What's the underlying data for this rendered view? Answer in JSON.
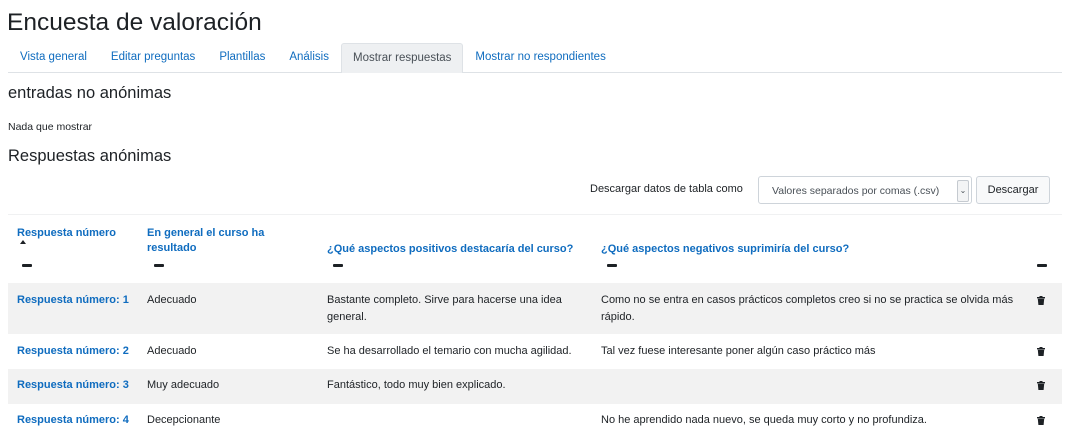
{
  "page": {
    "title": "Encuesta de valoración"
  },
  "tabs": [
    {
      "label": "Vista general"
    },
    {
      "label": "Editar preguntas"
    },
    {
      "label": "Plantillas"
    },
    {
      "label": "Análisis"
    },
    {
      "label": "Mostrar respuestas",
      "active": true
    },
    {
      "label": "Mostrar no respondientes"
    }
  ],
  "nonanonymous": {
    "heading": "entradas no anónimas",
    "empty_text": "Nada que mostrar"
  },
  "anonymous": {
    "heading": "Respuestas anónimas",
    "download_label": "Descargar datos de tabla como",
    "download_format": "Valores separados por comas (.csv)",
    "download_button": "Descargar"
  },
  "table": {
    "headers": {
      "number": "Respuesta número",
      "overall": "En general el curso ha resultado",
      "positive": "¿Qué aspectos positivos destacaría del curso?",
      "negative": "¿Qué aspectos negativos suprimiría del curso?"
    },
    "rows": [
      {
        "number": "Respuesta número: 1",
        "overall": "Adecuado",
        "positive": "Bastante completo. Sirve para hacerse una idea general.",
        "negative": "Como no se entra en casos prácticos completos creo si no se practica se olvida más rápido."
      },
      {
        "number": "Respuesta número: 2",
        "overall": "Adecuado",
        "positive": "Se ha desarrollado el temario con mucha agilidad.",
        "negative": "Tal vez fuese interesante poner algún caso práctico más"
      },
      {
        "number": "Respuesta número: 3",
        "overall": "Muy adecuado",
        "positive": "Fantástico, todo muy bien explicado.",
        "negative": ""
      },
      {
        "number": "Respuesta número: 4",
        "overall": "Decepcionante",
        "positive": "",
        "negative": "No he aprendido nada nuevo, se queda muy corto y no profundiza."
      }
    ]
  },
  "icons": {
    "sort": "sort-ascending-icon",
    "collapse": "collapse-column-icon",
    "delete": "trash-icon"
  },
  "colors": {
    "link": "#0f6cbf",
    "text": "#1d2125",
    "row_stripe": "#f2f2f2"
  }
}
